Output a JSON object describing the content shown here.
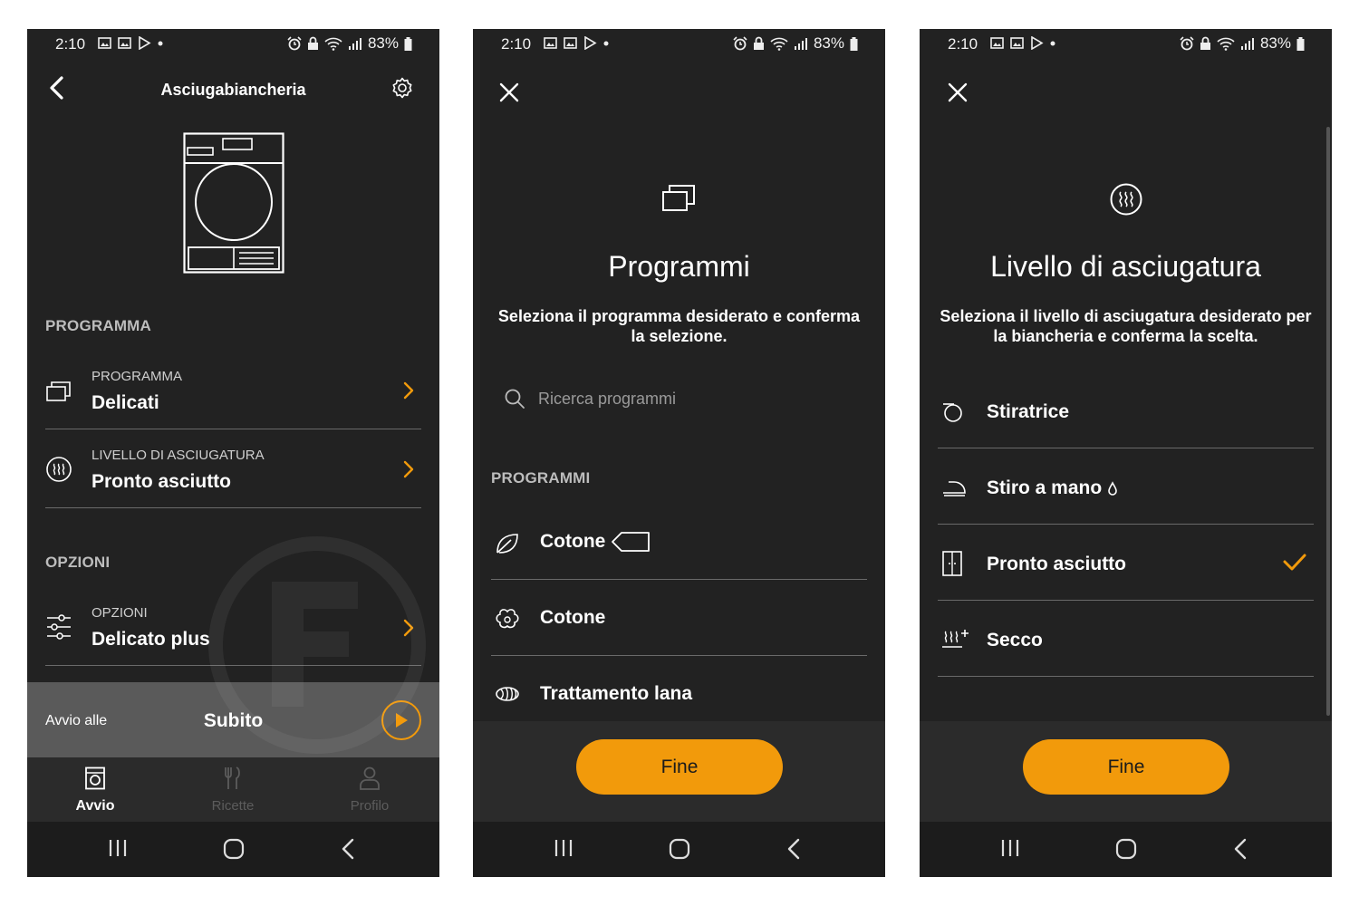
{
  "status": {
    "time": "2:10",
    "battery": "83%"
  },
  "screen1": {
    "title": "Asciugabiancheria",
    "section_programma": "PROGRAMMA",
    "row_programma": {
      "label": "PROGRAMMA",
      "value": "Delicati"
    },
    "row_livello": {
      "label": "LIVELLO DI ASCIUGATURA",
      "value": "Pronto asciutto"
    },
    "section_opzioni": "OPZIONI",
    "row_opzioni": {
      "label": "OPZIONI",
      "value": "Delicato plus"
    },
    "start": {
      "label": "Avvio alle",
      "value": "Subito"
    },
    "nav": {
      "home": "Avvio",
      "recipes": "Ricette",
      "profile": "Profilo"
    }
  },
  "screen2": {
    "title": "Programmi",
    "subtitle": "Seleziona il programma desiderato e conferma la selezione.",
    "search_placeholder": "Ricerca programmi",
    "section": "PROGRAMMI",
    "items": [
      {
        "label": "Cotone",
        "icon": "leaf-icon"
      },
      {
        "label": "Cotone",
        "icon": "cotton-icon"
      },
      {
        "label": "Trattamento lana",
        "icon": "wool-icon"
      }
    ],
    "done": "Fine"
  },
  "screen3": {
    "title": "Livello di asciugatura",
    "subtitle": "Seleziona il livello di asciugatura desiderato per la biancheria e conferma la scelta.",
    "items": [
      {
        "label": "Stiratrice",
        "icon": "ironer-icon"
      },
      {
        "label": "Stiro a mano",
        "icon": "iron-icon"
      },
      {
        "label": "Pronto asciutto",
        "icon": "wardrobe-icon",
        "selected": true
      },
      {
        "label": "Secco",
        "icon": "extra-dry-icon"
      }
    ],
    "done": "Fine"
  },
  "colors": {
    "accent": "#f29a0b",
    "background": "#222222",
    "divider": "#6a6a6a"
  }
}
